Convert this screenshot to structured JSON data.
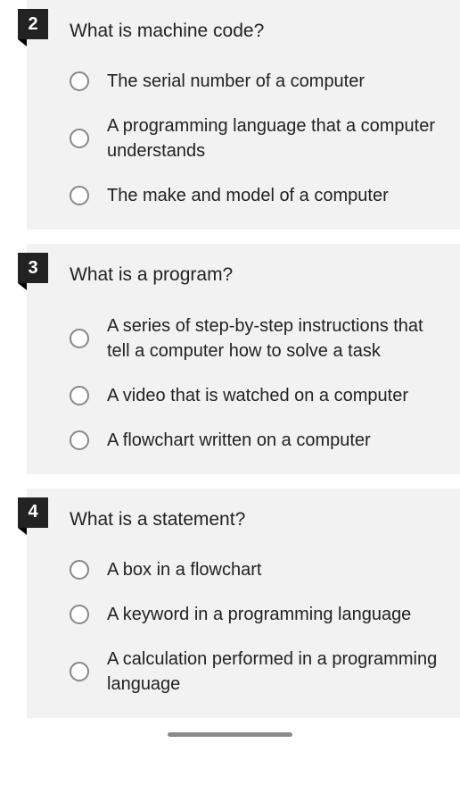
{
  "questions": [
    {
      "number": "2",
      "text": "What is machine code?",
      "answers": [
        "The serial number of a computer",
        "A programming language that a computer understands",
        "The make and model of a computer"
      ]
    },
    {
      "number": "3",
      "text": "What is a program?",
      "answers": [
        "A series of step-by-step instructions that tell a computer how to solve a task",
        "A video that is watched on a computer",
        "A flowchart written on a computer"
      ]
    },
    {
      "number": "4",
      "text": "What is a statement?",
      "answers": [
        "A box in a flowchart",
        "A keyword in a programming language",
        "A calculation performed in a programming language"
      ]
    }
  ]
}
